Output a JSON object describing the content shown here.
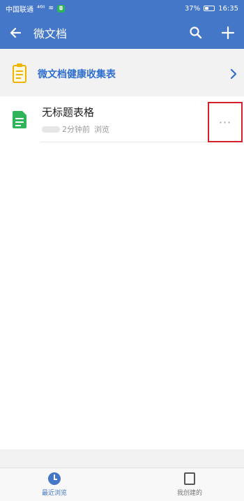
{
  "status_bar": {
    "carrier": "中国联通",
    "signal": "⁴⁶ᴵˡ",
    "wifi": "≋",
    "battery_percent": "37%",
    "battery_level": 0.37,
    "time": "16:35"
  },
  "header": {
    "title": "微文档",
    "back_icon": "back-arrow-icon",
    "search_icon": "search-icon",
    "add_icon": "plus-icon"
  },
  "health_card": {
    "title": "微文档健康收集表",
    "icon": "clipboard-icon"
  },
  "files": [
    {
      "title": "无标题表格",
      "time": "2分钟前",
      "action": "浏览",
      "icon": "spreadsheet-icon"
    }
  ],
  "more_icon": "···",
  "bottom_tabs": [
    {
      "label": "最近浏览",
      "icon": "clock-icon",
      "active": true
    },
    {
      "label": "我创建的",
      "icon": "document-icon",
      "active": false
    }
  ],
  "colors": {
    "primary": "#4577c8",
    "accent": "#2f6fd0",
    "spreadsheet_green": "#2fb45a",
    "clipboard_orange": "#f0b400",
    "highlight_red": "#d3202a"
  }
}
